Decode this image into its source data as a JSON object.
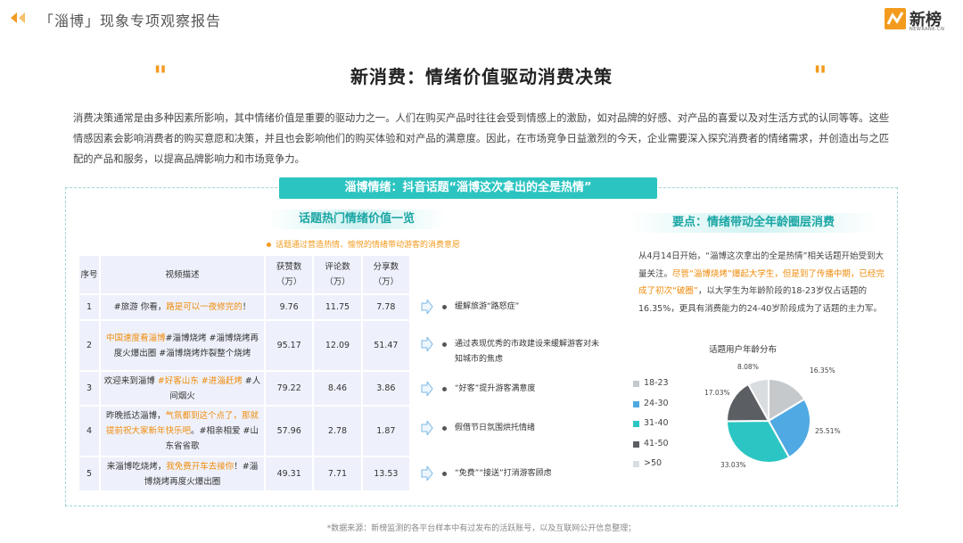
{
  "header": {
    "title": "「淄博」现象专项观察报告",
    "logo_text": "新榜",
    "logo_sub": "NEWRANK.CN",
    "accent": "#f29b1e"
  },
  "main_title": "新消费：情绪价值驱动消费决策",
  "quote_left": "\"",
  "quote_right": "\"",
  "intro": "消费决策通常是由多种因素所影响，其中情绪价值是重要的驱动力之一。人们在购买产品时往往会受到情感上的激励，如对品牌的好感、对产品的喜爱以及对生活方式的认同等等。这些情感因素会影响消费者的购买意愿和决策，并且也会影响他们的购买体验和对产品的满意度。因此，在市场竞争日益激烈的今天，企业需要深入探究消费者的情绪需求，并创造出与之匹配的产品和服务，以提高品牌影响力和市场竞争力。",
  "banner": "淄博情绪：抖音话题“淄博这次拿出的全是热情”",
  "left_section": {
    "heading": "话题热门情绪价值一览",
    "note": "话题通过营造热情、愉悦的情绪带动游客的消费意愿",
    "table": {
      "headers": [
        "序号",
        "视频描述",
        "获赞数\n（万）",
        "评论数\n（万）",
        "分享数\n（万）"
      ],
      "rows": [
        {
          "no": "1",
          "desc_parts": [
            {
              "t": "#旅游 你看，",
              "hl": false
            },
            {
              "t": "路是可以一夜修完的",
              "hl": true
            },
            {
              "t": "！",
              "hl": false
            }
          ],
          "likes": "9.76",
          "comments": "11.75",
          "shares": "7.78"
        },
        {
          "no": "2",
          "desc_parts": [
            {
              "t": "中国速度看淄博",
              "hl": true
            },
            {
              "t": "#淄博烧烤 #淄博烧烤再度火爆出圈 #淄博烧烤炸裂整个烧烤",
              "hl": false
            }
          ],
          "likes": "95.17",
          "comments": "12.09",
          "shares": "51.47"
        },
        {
          "no": "3",
          "desc_parts": [
            {
              "t": "欢迎来到淄博 ",
              "hl": false
            },
            {
              "t": "#好客山东 #进淄赶烤",
              "hl": true
            },
            {
              "t": " #人间烟火",
              "hl": false
            }
          ],
          "likes": "79.22",
          "comments": "8.46",
          "shares": "3.86"
        },
        {
          "no": "4",
          "desc_parts": [
            {
              "t": "昨晚抵达淄博，",
              "hl": false
            },
            {
              "t": "气氛都到这个点了，那就提前祝大家新年快乐吧",
              "hl": true
            },
            {
              "t": "。#相亲相爱 #山东省省歌",
              "hl": false
            }
          ],
          "likes": "57.96",
          "comments": "2.78",
          "shares": "1.87"
        },
        {
          "no": "5",
          "desc_parts": [
            {
              "t": "来淄博吃烧烤，",
              "hl": false
            },
            {
              "t": "我免费开车去接你",
              "hl": true
            },
            {
              "t": "！#淄博烧烤再度火爆出圈",
              "hl": false
            }
          ],
          "likes": "49.31",
          "comments": "7.71",
          "shares": "13.53"
        }
      ]
    },
    "insights": [
      "缓解旅游“路怒症”",
      "通过表现优秀的市政建设来缓解游客对未知城市的焦虑",
      "“好客”提升游客满意度",
      "假借节日氛围烘托情绪",
      "“免费”“接送”打消游客顾虑"
    ]
  },
  "right_section": {
    "heading": "要点：情绪带动全年龄圈层消费",
    "para_parts": [
      {
        "t": "从4月14日开始，“淄博这次拿出的全是热情”相关话题开始受到大量关注。",
        "hl": false
      },
      {
        "t": "尽管“淄博烧烤”爆起大学生，但是到了传播中期，已经完成了初次“破圈”",
        "hl": true
      },
      {
        "t": "，以大学生为年龄阶段的18-23岁仅占话题的16.35%，更具有消费能力的24-40岁阶段成为了话题的主力军。",
        "hl": false
      }
    ],
    "chart_title": "话题用户年龄分布"
  },
  "chart_data": {
    "type": "pie",
    "title": "话题用户年龄分布",
    "categories": [
      "18-23",
      "24-30",
      "31-40",
      "41-50",
      ">50"
    ],
    "values": [
      16.35,
      25.51,
      33.03,
      17.03,
      8.08
    ],
    "labels": [
      "16.35%",
      "25.51%",
      "33.03%",
      "17.03%",
      "8.08%"
    ],
    "colors": [
      "#c6c9cc",
      "#4fa9e2",
      "#2bc6c3",
      "#5b5e63",
      "#dadde0"
    ],
    "legend": "left"
  },
  "source": "*数据来源：新榜监测的各平台样本中有过发布的活跃账号，以及互联网公开信息整理；"
}
